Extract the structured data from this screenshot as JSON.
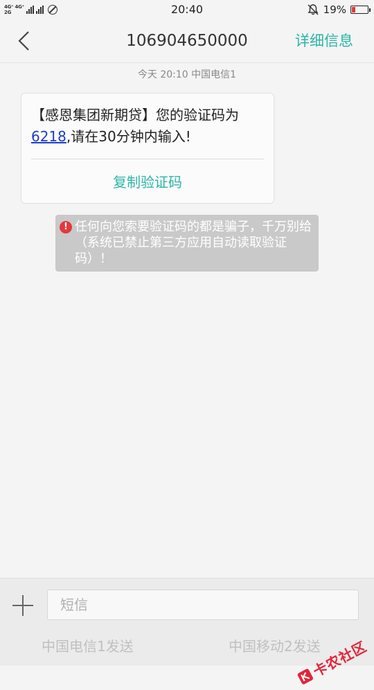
{
  "status_bar": {
    "network_top": "4G⁺ 4G⁺",
    "network_bottom": "2G",
    "time": "20:40",
    "battery_percent": "19%",
    "battery_level": 0.19,
    "battery_color": "#e23a3a"
  },
  "header": {
    "title": "106904650000",
    "details_label": "详细信息"
  },
  "message": {
    "meta": "今天  20:10  中国电信1",
    "text_before_code": "【感恩集团新期贷】您的验证码为",
    "code": "6218",
    "text_after_code": ",请在30分钟内输入!",
    "copy_button_label": "复制验证码"
  },
  "warning": {
    "icon_glyph": "!",
    "text": "任何向您索要验证码的都是骗子，千万别给（系统已禁止第三方应用自动读取验证码）！"
  },
  "composer": {
    "input_placeholder": "短信",
    "input_value": "",
    "send_sim1_label": "中国电信1发送",
    "send_sim2_label": "中国移动2发送"
  },
  "watermark": {
    "text": "卡农社区"
  },
  "colors": {
    "accent": "#2cb5a9",
    "link": "#1a3dc9",
    "warning_icon": "#e4393c",
    "watermark": "#e3253a"
  },
  "icons": {
    "back": "chevron-left-icon",
    "mute": "bell-off-icon",
    "add": "plus-icon",
    "no_sim": "no-sim-icon"
  }
}
